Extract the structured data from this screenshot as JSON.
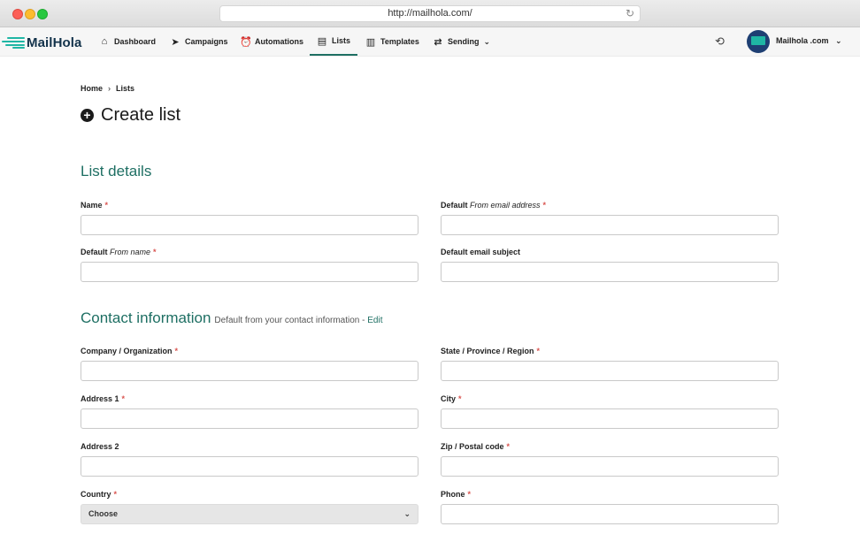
{
  "browser": {
    "url": "http://mailhola.com/"
  },
  "app": {
    "brand": "MailHola",
    "account": "Mailhola .com",
    "nav": [
      {
        "label": "Dashboard",
        "icon": "home-icon"
      },
      {
        "label": "Campaigns",
        "icon": "paper-plane-icon"
      },
      {
        "label": "Automations",
        "icon": "alarm-clock-icon"
      },
      {
        "label": "Lists",
        "icon": "contacts-book-icon",
        "active": true
      },
      {
        "label": "Templates",
        "icon": "template-icon"
      },
      {
        "label": "Sending",
        "icon": "arrows-exchange-icon",
        "dropdown": true
      }
    ]
  },
  "breadcrumb": {
    "home": "Home",
    "current": "Lists"
  },
  "page": {
    "title": "Create list"
  },
  "list_details": {
    "title": "List details",
    "name_label": "Name",
    "from_email_label_pre": "Default ",
    "from_email_label_em": "From email address",
    "from_name_label_pre": "Default ",
    "from_name_label_em": "From name",
    "subject_label": "Default email subject"
  },
  "contact": {
    "title": "Contact information",
    "note": "Default from your contact information - ",
    "edit": "Edit",
    "company_label": "Company / Organization",
    "state_label": "State / Province / Region",
    "address1_label": "Address 1",
    "city_label": "City",
    "address2_label": "Address 2",
    "zip_label": "Zip / Postal code",
    "country_label": "Country",
    "phone_label": "Phone",
    "country_value": "Choose"
  },
  "required_mark": "*"
}
